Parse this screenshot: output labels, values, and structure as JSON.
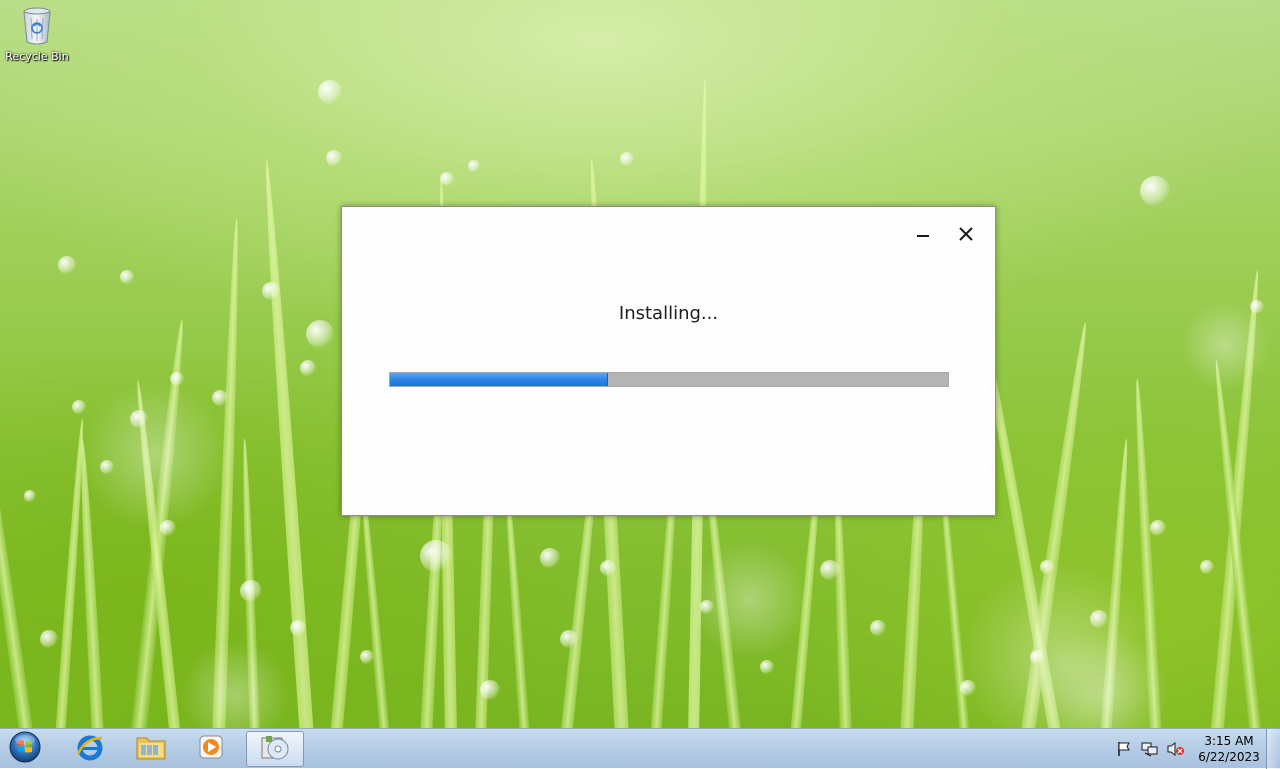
{
  "desktop": {
    "icons": [
      {
        "label": "Recycle Bin",
        "icon": "recycle-bin-icon"
      }
    ]
  },
  "installer": {
    "status": "Installing...",
    "progress": 0.39,
    "controls": {
      "minimize_icon": "minimize-icon",
      "close_icon": "close-icon"
    }
  },
  "taskbar": {
    "start_icon": "windows-start-orb-icon",
    "items": [
      {
        "name": "Internet Explorer",
        "icon": "internet-explorer-icon"
      },
      {
        "name": "Windows Explorer",
        "icon": "folder-explorer-icon"
      },
      {
        "name": "Windows Media Player",
        "icon": "media-player-icon"
      },
      {
        "name": "Installer",
        "icon": "installer-disc-icon",
        "active": true
      }
    ],
    "tray": [
      "action-center-flag-icon",
      "network-icon",
      "volume-muted-icon"
    ],
    "clock": {
      "time": "3:15 AM",
      "date": "6/22/2023"
    }
  },
  "colors": {
    "progress_fill": "#2f86e6",
    "progress_track": "#b4b4b4",
    "dialog_bg": "#fdfdfd",
    "taskbar": "#b6cde6"
  }
}
